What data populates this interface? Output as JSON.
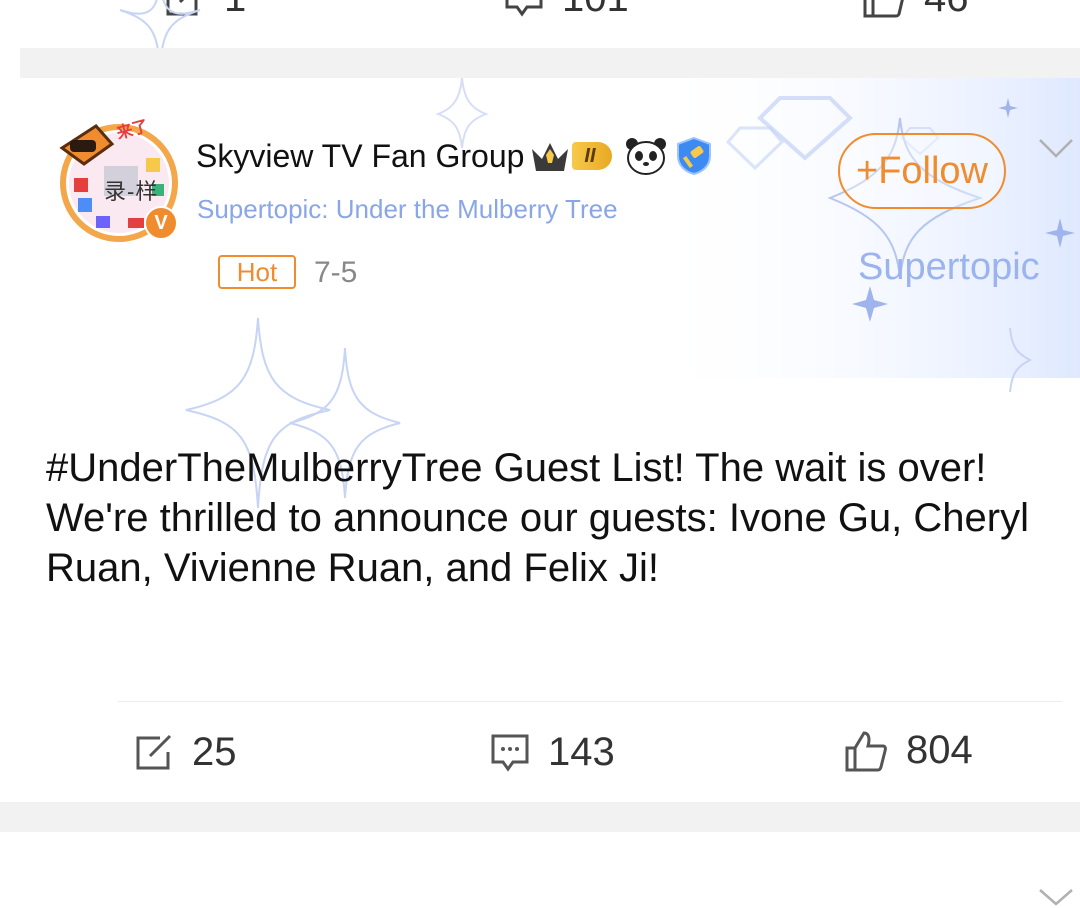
{
  "prev_post": {
    "actions": {
      "repost": "1",
      "comments": "101",
      "likes": "46"
    }
  },
  "post": {
    "author": {
      "name": "Skyview TV Fan Group",
      "avatar_text": "录-样",
      "avatar_sticker": "来了",
      "level_badge": "II",
      "icons": [
        "crown-icon",
        "panda-icon",
        "shield-hammer-icon"
      ]
    },
    "supertopic_line": "Supertopic: Under the Mulberry Tree",
    "hot_label": "Hot",
    "date": "7-5",
    "follow_label": "+Follow",
    "corner_label": "Supertopic",
    "body": "#UnderTheMulberryTree Guest List! The wait is over! We're thrilled to announce our guests: Ivone Gu, Cheryl Ruan, Vivienne Ruan, and Felix Ji!",
    "actions": {
      "repost": "25",
      "comments": "143",
      "likes": "804"
    }
  },
  "colors": {
    "accent_orange": "#f08c2e",
    "supertopic_blue": "#8aa6e8",
    "separator_gray": "#f2f2f2",
    "text_dark": "#1a1a1a",
    "muted_gray": "#888888"
  }
}
